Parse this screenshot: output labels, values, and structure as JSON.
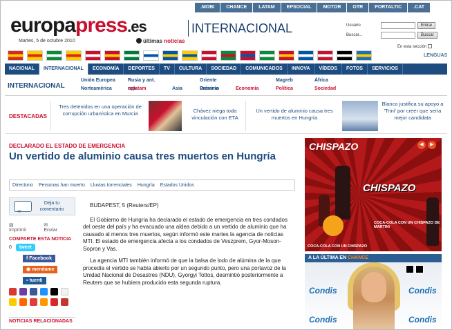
{
  "toplinks": [
    ".MOBI",
    "CHANCE",
    "LATAM",
    "EPSOCIAL",
    "MOTOR",
    "OTR",
    "PORTALTIC",
    ".CAT"
  ],
  "logo": {
    "part1": "europa",
    "part2": "press",
    "part3": ".es"
  },
  "section_title": "INTERNACIONAL",
  "date": "Martes, 5 de octubre 2010",
  "ultimas": {
    "prefix": "últimas",
    "highlight": "noticias"
  },
  "login": {
    "usuario_label": "Usuario",
    "buscar_label": "Buscar...",
    "entrar_button": "Entrar",
    "buscar_button": "Buscar",
    "entry_text": "En esta sección"
  },
  "lenguas": "LENGUAS",
  "flag_colors": [
    [
      "#d52b1e",
      "#ffcc00"
    ],
    [
      "#ffcc00",
      "#d52b1e"
    ],
    [
      "#0a8a3a",
      "#ffffff"
    ],
    [
      "#ffcc00",
      "#d52b1e"
    ],
    [
      "#c8102e",
      "#ffffff"
    ],
    [
      "#c8102e",
      "#ffcc00"
    ],
    [
      "#007a3d",
      "#ffffff"
    ],
    [
      "#ffffff",
      "#0057a8"
    ],
    [
      "#0057a8",
      "#ffcc00"
    ],
    [
      "#ffcc00",
      "#0057a8"
    ],
    [
      "#c8102e",
      "#ffffff"
    ],
    [
      "#0a8a3a",
      "#c8102e"
    ],
    [
      "#c8102e",
      "#0057a8"
    ],
    [
      "#0a8a3a",
      "#ffffff"
    ],
    [
      "#c8102e",
      "#ffcc00"
    ],
    [
      "#0057a8",
      "#ffffff"
    ],
    [
      "#c8102e",
      "#ffffff"
    ],
    [
      "#000000",
      "#ffffff"
    ],
    [
      "#1e70b5",
      "#ffcc00"
    ]
  ],
  "nav": [
    "NACIONAL",
    "INTERNACIONAL",
    "ECONOMÍA",
    "DEPORTES",
    "TV",
    "CULTURA",
    "SOCIEDAD",
    "COMUNICADOS",
    "INNOVA",
    "VÍDEOS",
    "FOTOS",
    "SERVICIOS"
  ],
  "subnav": {
    "label": "INTERNACIONAL",
    "row1": [
      "Unión Europea",
      "Rusia y ant. rep.",
      "Oriente Próximo",
      "Magreb",
      "África"
    ],
    "row2": [
      "Norteamérica",
      "eplatam",
      "Asia",
      "Oceanía",
      "Economía",
      "Política",
      "Sociedad"
    ]
  },
  "destacadas": {
    "label": "DESTACADAS",
    "items": [
      "Tres detenidos en una operación de corrupción urbanística en Murcia",
      "Chávez niega toda vinculación con ETA",
      "Un vertido de aluminio causa tres muertos en Hungría",
      "Blanco justifica su apoyo a 'Trini' por creer que sería mejor candidata"
    ]
  },
  "article": {
    "kicker": "DECLARADO EL ESTADO DE EMERGENCIA",
    "headline": "Un vertido de aluminio causa tres muertos en Hungría",
    "tags": [
      "Directorio",
      "Personas han muerto",
      "Lluvias torrenciales",
      "Hungría",
      "Estados Unidos"
    ],
    "dateline": "BUDAPEST, 5 (Reuters/EP)",
    "paragraphs": [
      "El Gobierno de Hungría ha declarado el estado de emergencia en tres condados del oeste del país y ha evacuado una aldea debido a un vertido de aluminio que ha causado al menos tres muertos, según informó este martes la agencia de noticias MTI. El estado de emergencia afecta a los condados de Veszprem, Gyor-Moson-Sopron y Vas.",
      "La agencia MTI también informó de que la balsa de lodo de alúmina de la que procedía el vertido se había abierto por un segundo punto, pero una portavoz de la Unidad Nacional de Desastres (NDU), Gyorgyi Tottos, desmintió posteriormente a Reuters que se hubiera producido esta segunda ruptura."
    ]
  },
  "social": {
    "comment": "Deja tu comentario",
    "imprimir": "Imprimir",
    "enviar": "Enviar",
    "compartir": "COMPARTE ESTA NOTICIA",
    "count": "0",
    "tweet": "tweet",
    "facebook": "Facebook",
    "meneame": "menéame",
    "tuenti": "tuenti",
    "relacionadas": "NOTICIAS RELACIONADAS"
  },
  "ad": {
    "brand": "CHISPAZO",
    "brand2": "CHISPAZO",
    "caption": "COCA-COLA CON UN CHISPAZO DE MARTINI",
    "caption2": "COCA-COLA CON UN CHISPAZO"
  },
  "chance": {
    "prefix": "A LA ÚLTIMA EN",
    "highlight": "CHANCE"
  },
  "condis": "Condis"
}
